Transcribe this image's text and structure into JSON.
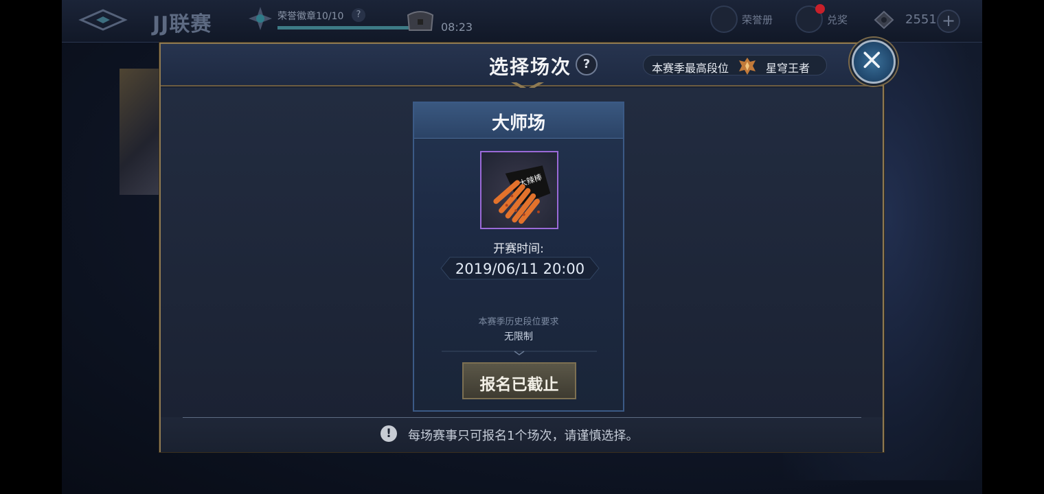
{
  "topbar": {
    "title": "JJ联赛",
    "badge_label": "荣誉徽章10/10",
    "badge_help": "?",
    "badge_progress": 1.0,
    "timer": "08:23",
    "honor_book_label": "荣誉册",
    "redeem_label": "兑奖",
    "coins": "2551",
    "plus": "+"
  },
  "modal": {
    "title": "选择场次",
    "help": "?",
    "season_rank_label": "本赛季最高段位",
    "season_rank_value": "星穹王者",
    "close_icon": "close-icon"
  },
  "match": {
    "name": "大师场",
    "reward_icon": "snack-bag-icon",
    "start_label": "开赛时间:",
    "start_time": "2019/06/11 20:00",
    "requirement_label": "本赛季历史段位要求",
    "requirement_value": "无限制",
    "signup_button": "报名已截止"
  },
  "footer": {
    "note": "每场赛事只可报名1个场次，请谨慎选择。",
    "warn": "!"
  },
  "colors": {
    "accent_gold": "#8f7a52",
    "card_border": "#3b5a86",
    "reward_border": "#9b6ad8",
    "notification_red": "#c8202a"
  }
}
